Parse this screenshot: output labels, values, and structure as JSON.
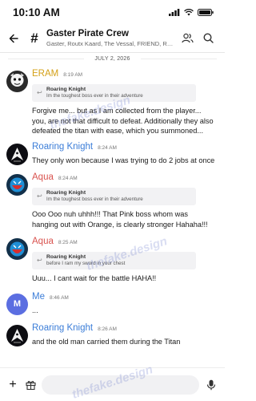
{
  "status": {
    "time": "10:10 AM"
  },
  "header": {
    "title": "Gaster Pirate Crew",
    "subtitle": "Gaster, Routx Kaard, The Vessal, FRIEND, Ro..."
  },
  "chat": {
    "date": "JULY 2, 2026",
    "messages": [
      {
        "author": "ERAM",
        "author_color": "#d4a017",
        "time": "8:19 AM",
        "reply_author": "Roaring Knight",
        "reply_text": "Im the toughest boss ever in their adventure",
        "text": "Forgive me... but as I am collected from the player... you, are not that difficult to defeat. Additionally they also defeated the titan with ease, which you summoned..."
      },
      {
        "author": "Roaring Knight",
        "author_color": "#3b7dd8",
        "time": "8:24 AM",
        "text": "They only won because I was trying to do 2 jobs at once"
      },
      {
        "author": "Aqua",
        "author_color": "#d9534f",
        "time": "8:24 AM",
        "reply_author": "Roaring Knight",
        "reply_text": "Im the toughest boss ever in their adventure",
        "text": "Ooo Ooo nuh uhhh!!! That Pink boss whom was hanging out with Orange, is clearly stronger Hahaha!!!"
      },
      {
        "author": "Aqua",
        "author_color": "#d9534f",
        "time": "8:25 AM",
        "reply_author": "Roaring Knight",
        "reply_text": "before I ram my sword in your chest",
        "text": "Uuu... I cant wait for the battle HAHA!!"
      },
      {
        "author": "Me",
        "author_color": "#3b7dd8",
        "time": "8:46 AM",
        "avatar_letter": "M",
        "avatar_color": "#5b6ee1",
        "text": "..."
      },
      {
        "author": "Roaring Knight",
        "author_color": "#3b7dd8",
        "time": "8:26 AM",
        "text": "and the old man carried them during the Titan"
      }
    ]
  },
  "watermark": "thefake.design",
  "colors": {
    "accent": "#3b7dd8",
    "divider": "#e6e6e6"
  }
}
